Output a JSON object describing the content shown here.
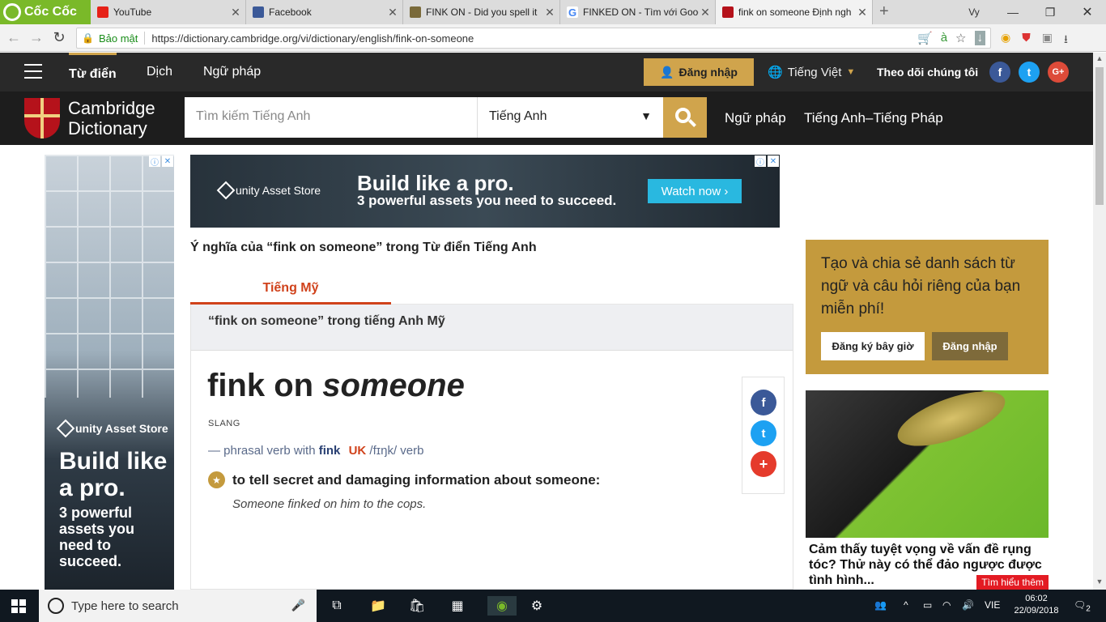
{
  "browser": {
    "brand": "Cốc Cốc",
    "tabs": [
      {
        "title": "YouTube",
        "fav_color": "#e62117"
      },
      {
        "title": "Facebook",
        "fav_color": "#3b5998"
      },
      {
        "title": "FINK ON - Did you spell it",
        "fav_color": "#7a6a3a"
      },
      {
        "title": "FINKED ON - Tìm với Goog",
        "fav_color": "#4285f4"
      },
      {
        "title": "fink on someone Định ngh",
        "fav_color": "#b5121b"
      }
    ],
    "security_label": "Bảo mật",
    "url": "https://dictionary.cambridge.org/vi/dictionary/english/fink-on-someone",
    "translate_glyph": "à",
    "profile_initials": "Vy"
  },
  "nav": {
    "items": [
      "Từ điển",
      "Dịch",
      "Ngữ pháp"
    ],
    "login": "Đăng nhập",
    "language": "Tiếng Việt",
    "follow": "Theo dõi chúng tôi"
  },
  "header": {
    "logo_line1": "Cambridge",
    "logo_line2": "Dictionary",
    "search_placeholder": "Tìm kiếm Tiếng Anh",
    "dict_select": "Tiếng Anh",
    "links": [
      "Ngữ pháp",
      "Tiếng Anh–Tiếng Pháp"
    ]
  },
  "ads": {
    "brand": "unity Asset Store",
    "headline": "Build like a pro.",
    "left_line1": "Build like",
    "left_line2": "a pro.",
    "left_sub": "3 powerful assets you need to succeed.",
    "sub": "3 powerful assets you need to succeed.",
    "cta": "Watch now ›"
  },
  "entry": {
    "meaning_title": "Ý nghĩa của “fink on someone” trong Từ điển Tiếng Anh",
    "tab": "Tiếng Mỹ",
    "section_title": "“fink on someone” trong tiếng Anh Mỹ",
    "headword_main": "fink on",
    "headword_italic": "someone",
    "register": "SLANG",
    "pv_prefix": "— phrasal verb with",
    "pv_word": "fink",
    "region": "UK",
    "pron": "/fɪŋk/",
    "pos": "verb",
    "definition": "to tell secret and damaging information about someone:",
    "example": "Someone finked on him to the cops."
  },
  "promo": {
    "text": "Tạo và chia sẻ danh sách từ ngữ và câu hỏi riêng của bạn miễn phí!",
    "signup": "Đăng ký bây giờ",
    "login": "Đăng nhập"
  },
  "right_ad": {
    "caption": "Cảm thấy tuyệt vọng về vấn đề rụng tóc? Thử này có thể đảo ngược được tình hình...",
    "more": "Tìm hiểu thêm"
  },
  "taskbar": {
    "search": "Type here to search",
    "lang": "VIE",
    "time": "06:02",
    "date": "22/09/2018",
    "notifications": "2"
  }
}
